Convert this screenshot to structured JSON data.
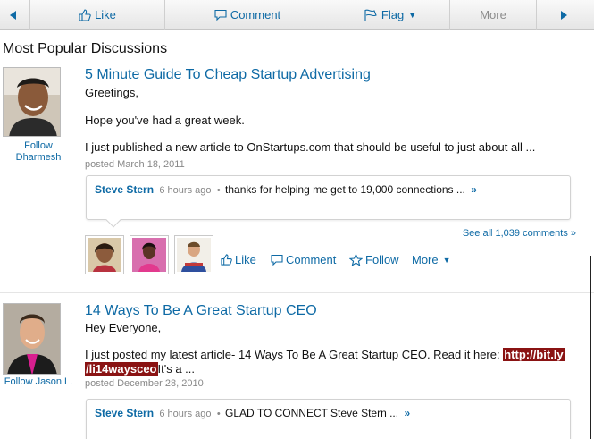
{
  "toolbar": {
    "prev_icon": "chevron-left-icon",
    "like_label": "Like",
    "comment_label": "Comment",
    "flag_label": "Flag",
    "more_label": "More",
    "next_icon": "chevron-right-icon"
  },
  "section_title": "Most Popular Discussions",
  "discussions": [
    {
      "follow_label": "Follow",
      "follow_name": "Dharmesh",
      "title": "5 Minute Guide To Cheap Startup Advertising",
      "greeting": "Greetings,",
      "line2": "Hope you've had a great week.",
      "line3": "I just published a new article to OnStartups.com that should be useful to just about all ...",
      "posted": "posted March 18, 2011",
      "comment": {
        "author": "Steve Stern",
        "time": "6 hours ago",
        "separator": "•",
        "text": "thanks for helping me get to 19,000 connections ...",
        "more": "»"
      },
      "see_all": "See all 1,039 comments »",
      "actions": {
        "like": "Like",
        "comment": "Comment",
        "follow": "Follow",
        "more": "More"
      }
    },
    {
      "follow_label": "Follow Jason L.",
      "title": "14 Ways To Be A Great Startup CEO",
      "greeting": "Hey Everyone,",
      "line2_prefix": "I just posted my latest article- 14 Ways To Be A Great Startup CEO. Read it here: ",
      "link_part1": "http://bit.ly",
      "link_part2": "/li14waysceo",
      "line3_suffix": "It's a ...",
      "posted": "posted December 28, 2010",
      "comment": {
        "author": "Steve Stern",
        "time": "6 hours ago",
        "separator": "•",
        "text": "GLAD TO CONNECT Steve Stern ...",
        "more": "»"
      }
    }
  ],
  "colors": {
    "link": "#0e6aa5",
    "highlight": "#8a1313",
    "meta": "#888888"
  }
}
